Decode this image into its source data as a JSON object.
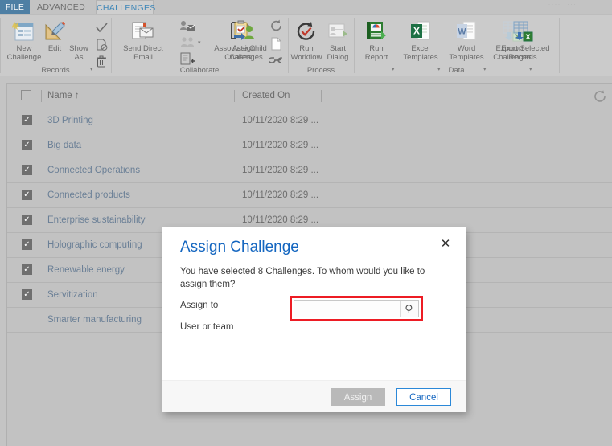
{
  "tabs": [
    {
      "id": "file",
      "label": "FILE"
    },
    {
      "id": "advanced-find",
      "label": "ADVANCED FIND"
    },
    {
      "id": "challenges",
      "label": "CHALLENGES"
    }
  ],
  "top_faint_text": "····  ····",
  "ribbon": {
    "groups": [
      {
        "id": "records",
        "label": "Records"
      },
      {
        "id": "collaborate",
        "label": "Collaborate"
      },
      {
        "id": "process",
        "label": "Process"
      },
      {
        "id": "data",
        "label": "Data"
      }
    ],
    "buttons": {
      "new_challenge": "New\nChallenge",
      "edit": "Edit",
      "show_as": "Show\nAs",
      "send_direct_email": "Send Direct\nEmail",
      "associate_child_cases": "Associate Child\nCases",
      "assign_challenges": "Assign\nChallenges",
      "run_workflow": "Run\nWorkflow",
      "start_dialog": "Start\nDialog",
      "run_report": "Run\nReport",
      "excel_templates": "Excel\nTemplates",
      "word_templates": "Word\nTemplates",
      "export_challenges": "Export\nChallenges",
      "export_selected_records": "Export Selected\nRecords"
    },
    "icons": {
      "new_challenge": "new-record-icon",
      "edit": "edit-pencil-ruler-icon",
      "show_as": "show-as-icon",
      "check": "check-icon",
      "deactivate": "deactivate-document-icon",
      "delete": "trash-icon",
      "send_direct_email": "email-document-icon",
      "add_connection": "add-connection-icon",
      "connections": "connections-icon",
      "add_to_queue": "add-to-queue-icon",
      "associate_child_cases": "associate-child-cases-icon",
      "assign_challenges": "assign-clipboard-user-icon",
      "refresh_sync": "sync-circle-icon",
      "page": "page-icon",
      "link": "link-chain-icon",
      "run_workflow": "run-workflow-icon",
      "start_dialog": "start-dialog-icon",
      "run_report": "run-report-icon",
      "excel_templates": "excel-icon",
      "word_templates": "word-icon",
      "export_challenges": "export-to-excel-icon",
      "export_selected_records": "export-selected-excel-icon"
    }
  },
  "grid": {
    "columns": [
      {
        "id": "select",
        "label": ""
      },
      {
        "id": "name",
        "label": "Name",
        "sort": "↑"
      },
      {
        "id": "created_on",
        "label": "Created On"
      }
    ],
    "select_all_checked": false,
    "refresh_icon": "refresh-icon",
    "rows": [
      {
        "name": "3D Printing",
        "created_on": "10/11/2020 8:29 ...",
        "checked": true
      },
      {
        "name": "Big data",
        "created_on": "10/11/2020 8:29 ...",
        "checked": true
      },
      {
        "name": "Connected Operations",
        "created_on": "10/11/2020 8:29 ...",
        "checked": true
      },
      {
        "name": "Connected products",
        "created_on": "10/11/2020 8:29 ...",
        "checked": true
      },
      {
        "name": "Enterprise sustainability",
        "created_on": "10/11/2020 8:29 ...",
        "checked": true
      },
      {
        "name": "Holographic computing",
        "created_on": "",
        "checked": true
      },
      {
        "name": "Renewable energy",
        "created_on": "",
        "checked": true
      },
      {
        "name": "Servitization",
        "created_on": "",
        "checked": true
      },
      {
        "name": "Smarter manufacturing",
        "created_on": "",
        "checked": false
      }
    ]
  },
  "dialog": {
    "title": "Assign Challenge",
    "close_icon": "close-icon",
    "message": "You have selected 8 Challenges. To whom would you like to assign them?",
    "fields": [
      {
        "id": "assign-to",
        "label": "Assign to",
        "value": "User or team"
      },
      {
        "id": "user-or-team",
        "label": "User or team",
        "value": "",
        "placeholder": ""
      }
    ],
    "lookup_icon": "search-lookup-icon",
    "buttons": {
      "assign": "Assign",
      "cancel": "Cancel"
    },
    "highlight_color": "#ed1c24",
    "accent_color": "#1466c0"
  }
}
